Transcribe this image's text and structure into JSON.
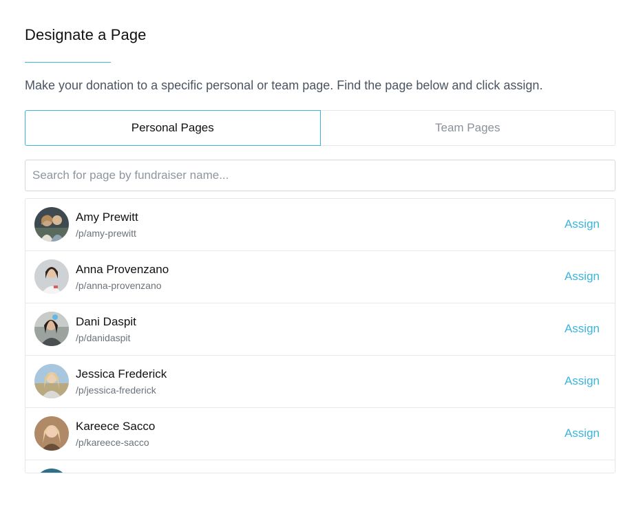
{
  "header": {
    "title": "Designate a Page",
    "subtitle": "Make your donation to a specific personal or team page. Find the page below and click assign."
  },
  "tabs": [
    {
      "label": "Personal Pages",
      "active": true
    },
    {
      "label": "Team Pages",
      "active": false
    }
  ],
  "search": {
    "placeholder": "Search for page by fundraiser name...",
    "value": ""
  },
  "pages": [
    {
      "name": "Amy Prewitt",
      "slug": "/p/amy-prewitt",
      "action": "Assign"
    },
    {
      "name": "Anna Provenzano",
      "slug": "/p/anna-provenzano",
      "action": "Assign"
    },
    {
      "name": "Dani Daspit",
      "slug": "/p/danidaspit",
      "action": "Assign"
    },
    {
      "name": "Jessica Frederick",
      "slug": "/p/jessica-frederick",
      "action": "Assign"
    },
    {
      "name": "Kareece Sacco",
      "slug": "/p/kareece-sacco",
      "action": "Assign"
    }
  ],
  "colors": {
    "accent": "#3bb4dc",
    "border": "#e3e6ea",
    "text_muted": "#6b7279"
  }
}
